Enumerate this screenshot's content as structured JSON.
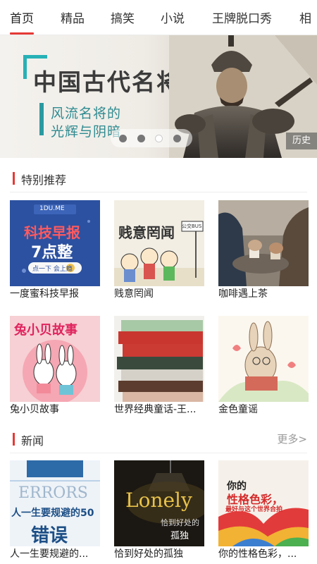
{
  "tabs": [
    {
      "label": "首页",
      "active": true
    },
    {
      "label": "精品",
      "active": false
    },
    {
      "label": "搞笑",
      "active": false
    },
    {
      "label": "小说",
      "active": false
    },
    {
      "label": "王牌脱口秀",
      "active": false
    },
    {
      "label": "相",
      "active": false
    }
  ],
  "banner": {
    "title": "中国古代名将",
    "subtitle_line1": "风流名将的",
    "subtitle_line2": "光辉与阴暗",
    "category_tag": "历史",
    "slide_count": 4,
    "active_slide": 3
  },
  "sections": {
    "featured": {
      "title": "特别推荐",
      "items": [
        {
          "title": "一度蜜科技早报",
          "cover_brand": "1DU.ME",
          "cover_line1": "科技早报",
          "cover_line2": "7点整",
          "cover_button": "点一下  会上瘾"
        },
        {
          "title": "贱意罔闻",
          "cover_line1": "贱意罔闻",
          "cover_badge": "公交BUS"
        },
        {
          "title": "咖啡遇上茶"
        },
        {
          "title": "兔小贝故事",
          "cover_line1": "兔小贝故事"
        },
        {
          "title": "世界经典童话-王..."
        },
        {
          "title": "金色童谣"
        }
      ]
    },
    "news": {
      "title": "新闻",
      "more_label": "更多>",
      "items": [
        {
          "title": "人一生要规避的...",
          "cover_line1": "ERRORS",
          "cover_line2": "人一生要规避的50",
          "cover_line3": "错误"
        },
        {
          "title": "恰到好处的孤独",
          "cover_line1": "Lonely",
          "cover_line2": "恰到好处的",
          "cover_line3": "孤独"
        },
        {
          "title": "你的性格色彩，...",
          "cover_line1": "你的",
          "cover_line2": "性格色彩，",
          "cover_line3": "最好与这个世界合拍"
        }
      ]
    }
  },
  "colors": {
    "accent": "#e53935",
    "banner_teal": "#27b1b6"
  }
}
